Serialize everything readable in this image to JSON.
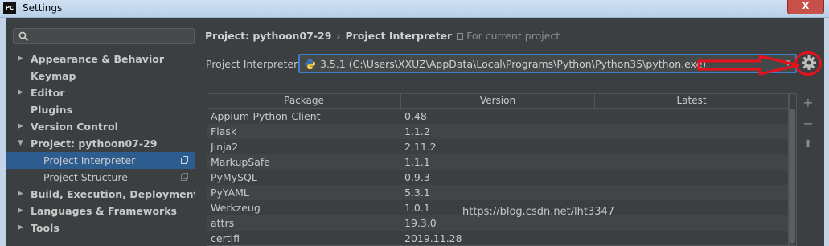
{
  "window": {
    "title": "Settings",
    "app_icon_text": "PC",
    "close_label": "X"
  },
  "sidebar": {
    "search_placeholder": "",
    "items": [
      {
        "label": "Appearance & Behavior",
        "arrow": "▶"
      },
      {
        "label": "Keymap",
        "arrow": ""
      },
      {
        "label": "Editor",
        "arrow": "▶"
      },
      {
        "label": "Plugins",
        "arrow": ""
      },
      {
        "label": "Version Control",
        "arrow": "▶"
      },
      {
        "label": "Project: pythoon07-29",
        "arrow": "▼"
      },
      {
        "label": "Project Interpreter",
        "arrow": "",
        "selected": true
      },
      {
        "label": "Project Structure",
        "arrow": ""
      },
      {
        "label": "Build, Execution, Deployment",
        "arrow": "▶"
      },
      {
        "label": "Languages & Frameworks",
        "arrow": "▶"
      },
      {
        "label": "Tools",
        "arrow": "▶"
      }
    ]
  },
  "breadcrumb": {
    "project": "Project: pythoon07-29",
    "separator": "›",
    "page": "Project Interpreter",
    "note": "For current project"
  },
  "interpreter": {
    "label": "Project Interpreter:",
    "value": "3.5.1 (C:\\Users\\XXUZ\\AppData\\Local\\Programs\\Python\\Python35\\python.exe)"
  },
  "packages": {
    "columns": [
      "Package",
      "Version",
      "Latest"
    ],
    "rows": [
      [
        "Appium-Python-Client",
        "0.48"
      ],
      [
        "Flask",
        "1.1.2"
      ],
      [
        "Jinja2",
        "2.11.2"
      ],
      [
        "MarkupSafe",
        "1.1.1"
      ],
      [
        "PyMySQL",
        "0.9.3"
      ],
      [
        "PyYAML",
        "5.3.1"
      ],
      [
        "Werkzeug",
        "1.0.1"
      ],
      [
        "attrs",
        "19.3.0"
      ],
      [
        "certifi",
        "2019.11.28"
      ]
    ]
  },
  "side_buttons": {
    "add": "+",
    "remove": "−",
    "upgrade": "⬆"
  },
  "watermark": "https://blog.csdn.net/lht3347",
  "colors": {
    "accent": "#3d7fc7",
    "selection": "#2d5c8f",
    "annotation": "#e8101c"
  }
}
